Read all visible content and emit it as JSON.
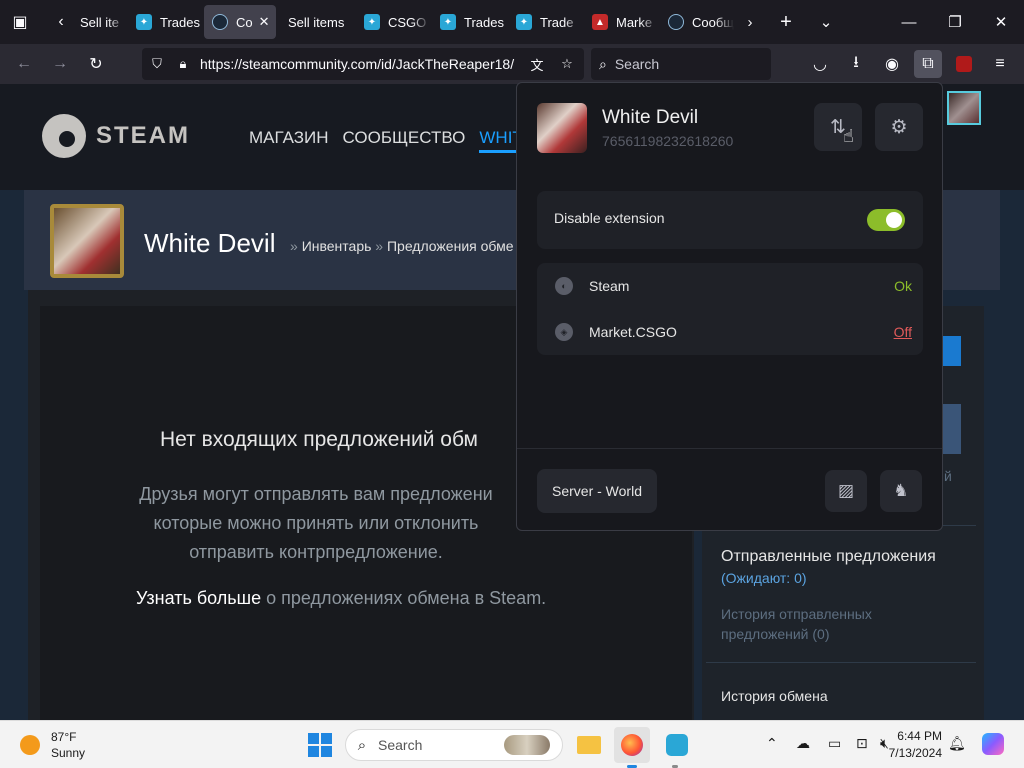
{
  "browser": {
    "tabs": [
      {
        "label": "Sell ite",
        "favicon": "none"
      },
      {
        "label": "Trades",
        "favicon": "csgo-icon"
      },
      {
        "label": "Co",
        "favicon": "steam-icon",
        "active": true
      },
      {
        "label": "Sell items",
        "favicon": "none"
      },
      {
        "label": "CSGO",
        "favicon": "csgo-icon"
      },
      {
        "label": "Trades",
        "favicon": "csgo-icon"
      },
      {
        "label": "Trade",
        "favicon": "csgo-icon"
      },
      {
        "label": "Marke",
        "favicon": "market-icon"
      },
      {
        "label": "Сообщ",
        "favicon": "steam-icon"
      }
    ],
    "url": "https://steamcommunity.com/id/JackTheReaper18/",
    "search_placeholder": "Search"
  },
  "steam": {
    "logo_text": "STEAM",
    "nav": [
      "МАГАЗИН",
      "СООБЩЕСТВО",
      "WHITE"
    ],
    "profile_name": "White Devil",
    "breadcrumb_1": "Инвентарь",
    "breadcrumb_2": "Предложения обме",
    "breadcrumb_sep": "»",
    "empty_title": "Нет входящих предложений обм",
    "empty_desc": "Друзья могут отправлять вам предложени которые можно принять или отклонить отправить контрпредложение.",
    "learn_more_bold": "Узнать больше",
    "learn_more_rest": "о предложениях обмена в Steam.",
    "sidebar_hint": "й",
    "sent_title": "Отправленные предложения",
    "sent_count": "(Ожидают: 0)",
    "sent_history": "История отправленных предложений (0)",
    "trade_history": "История обмена"
  },
  "extension": {
    "user_name": "White Devil",
    "steam_id": "76561198232618260",
    "disable_label": "Disable extension",
    "disable_enabled": true,
    "services": [
      {
        "name": "Steam",
        "status": "Ok"
      },
      {
        "name": "Market.CSGO",
        "status": "Off"
      }
    ],
    "server_label": "Server - World"
  },
  "taskbar": {
    "weather_temp": "87°F",
    "weather_desc": "Sunny",
    "search_label": "Search",
    "time": "6:44 PM",
    "date": "7/13/2024"
  },
  "colors": {
    "steam_blue": "#1a9fff",
    "ok_green": "#8cbd2a",
    "off_red": "#e05a5a",
    "toggle_on": "#8cbd2a"
  }
}
